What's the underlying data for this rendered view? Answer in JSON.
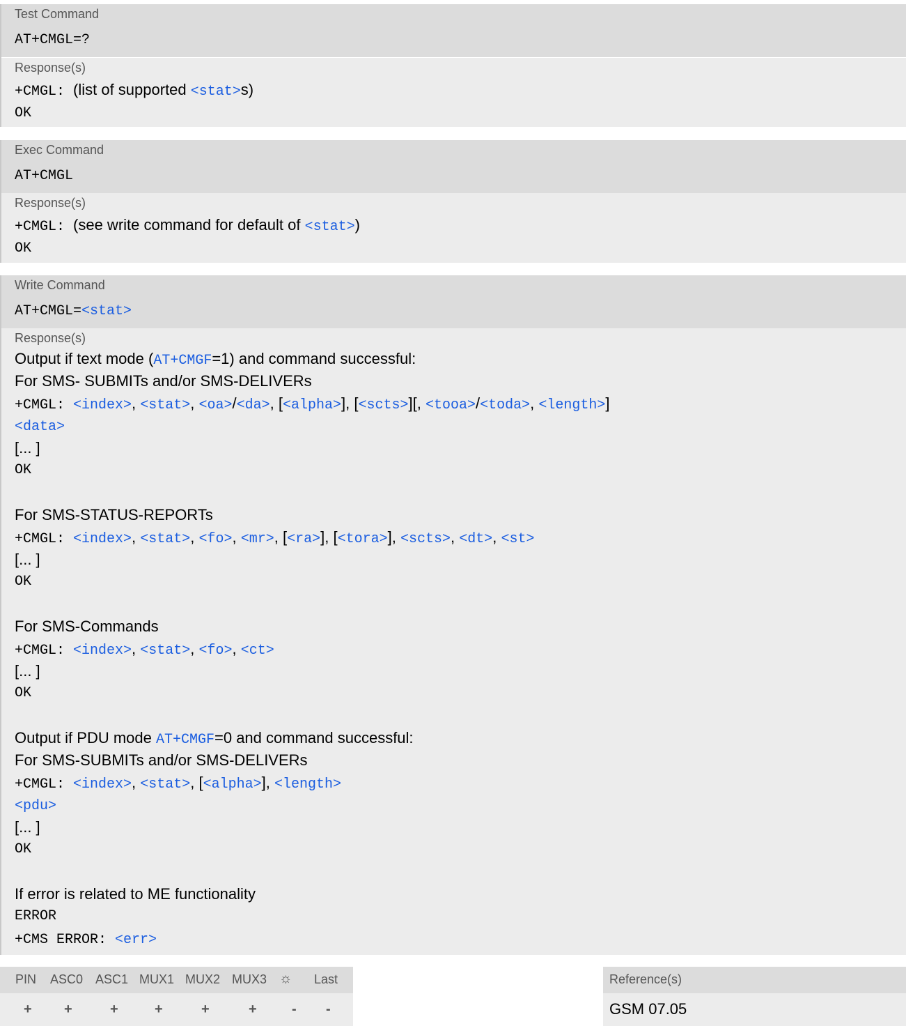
{
  "test": {
    "label": "Test Command",
    "command": "AT+CMGL=?",
    "response_label": "Response(s)",
    "resp_prefix": "+CMGL: ",
    "resp_text_a": "(list of supported ",
    "resp_param": "<stat>",
    "resp_text_b": "s)",
    "ok": "OK"
  },
  "exec": {
    "label": "Exec Command",
    "command": "AT+CMGL",
    "response_label": "Response(s)",
    "resp_prefix": "+CMGL: ",
    "resp_text_a": "(see write command for default of ",
    "resp_param": "<stat>",
    "resp_text_b": ")",
    "ok": "OK"
  },
  "write": {
    "label": "Write Command",
    "command_prefix": "AT+CMGL=",
    "command_param": "<stat>",
    "response_label": "Response(s)",
    "text_mode_line_a": "Output if text mode (",
    "text_mode_link": "AT+CMGF",
    "text_mode_line_b": "=1) and command successful:",
    "sub_deliver_1": "For SMS- SUBMITs and/or SMS-DELIVERs",
    "ellipsis": "[... ]",
    "ok": "OK",
    "status_reports": "For SMS-STATUS-REPORTs",
    "commands": "For SMS-Commands",
    "pdu_mode_line_a": "Output if PDU mode ",
    "pdu_mode_link": "AT+CMGF",
    "pdu_mode_line_b": "=0 and command successful:",
    "sub_deliver_2": "For SMS-SUBMITs and/or SMS-DELIVERs",
    "error_intro": "If error is related to ME functionality",
    "error": "ERROR",
    "cms_error_prefix": "+CMS ERROR: ",
    "cms_error_param": "<err>",
    "prefix": "+CMGL: ",
    "p": {
      "index": "<index>",
      "stat": "<stat>",
      "oa": "<oa>",
      "da": "<da>",
      "alpha": "<alpha>",
      "scts": "<scts>",
      "tooa": "<tooa>",
      "toda": "<toda>",
      "length": "<length>",
      "data": "<data>",
      "fo": "<fo>",
      "mr": "<mr>",
      "ra": "<ra>",
      "tora": "<tora>",
      "dt": "<dt>",
      "st": "<st>",
      "ct": "<ct>",
      "pdu": "<pdu>"
    }
  },
  "footer": {
    "columns": [
      "PIN",
      "ASC0",
      "ASC1",
      "MUX1",
      "MUX2",
      "MUX3",
      "☼",
      "Last"
    ],
    "values": [
      "+",
      "+",
      "+",
      "+",
      "+",
      "+",
      "-",
      "-"
    ],
    "reference_label": "Reference(s)",
    "reference": "GSM 07.05"
  }
}
